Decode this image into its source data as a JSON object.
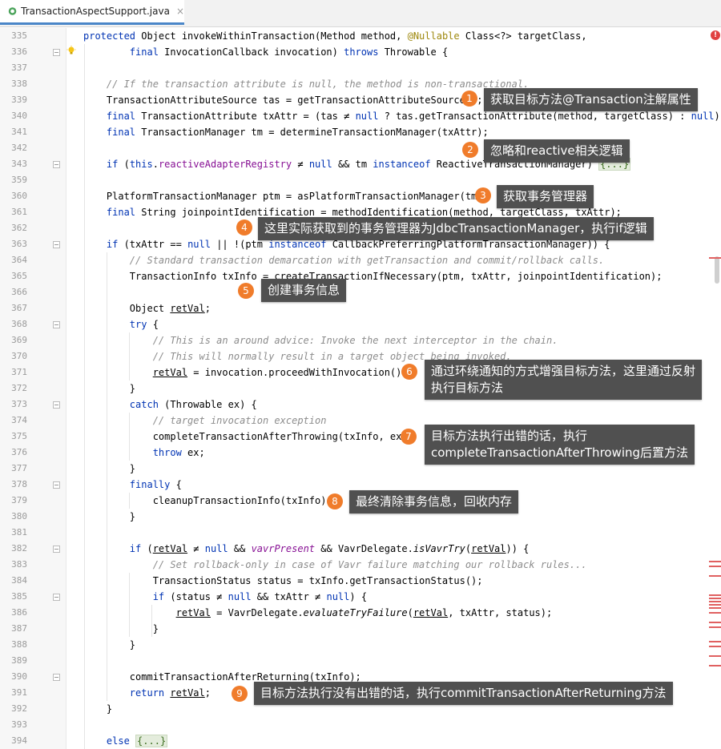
{
  "tab": {
    "filename": "TransactionAspectSupport.java",
    "close": "×"
  },
  "lines": [
    {
      "n": "335",
      "html": "<span class=\"kw\">protected</span> Object invokeWithinTransaction(Method method, <span class=\"ann\">@Nullable</span> Class&lt;?&gt; targetClass,"
    },
    {
      "n": "336",
      "html": "        <span class=\"kw\">final</span> InvocationCallback invocation) <span class=\"kw\">throws</span> Throwable {"
    },
    {
      "n": "337",
      "html": ""
    },
    {
      "n": "338",
      "html": "    <span class=\"cm\">// If the transaction attribute is null, the method is non-transactional.</span>"
    },
    {
      "n": "339",
      "html": "    TransactionAttributeSource tas = getTransactionAttributeSource();"
    },
    {
      "n": "340",
      "html": "    <span class=\"kw\">final</span> TransactionAttribute txAttr = (tas ≠ <span class=\"kw\">null</span> ? tas.getTransactionAttribute(method, targetClass) : <span class=\"kw\">null</span>);"
    },
    {
      "n": "341",
      "html": "    <span class=\"kw\">final</span> TransactionManager tm = determineTransactionManager(txAttr);"
    },
    {
      "n": "342",
      "html": ""
    },
    {
      "n": "343",
      "html": "    <span class=\"kw\">if</span> (<span class=\"kw\">this</span>.<span class=\"fld\">reactiveAdapterRegistry</span> ≠ <span class=\"kw\">null</span> &amp;&amp; tm <span class=\"kw\">instanceof</span> ReactiveTransactionManager) <span class=\"fold\">{...}</span>"
    },
    {
      "n": "359",
      "html": ""
    },
    {
      "n": "360",
      "html": "    PlatformTransactionManager ptm = asPlatformTransactionManager(tm);"
    },
    {
      "n": "361",
      "html": "    <span class=\"kw\">final</span> String joinpointIdentification = methodIdentification(method, targetClass, txAttr);"
    },
    {
      "n": "362",
      "html": ""
    },
    {
      "n": "363",
      "html": "    <span class=\"kw\">if</span> (txAttr == <span class=\"kw\">null</span> || !(ptm <span class=\"kw\">instanceof</span> CallbackPreferringPlatformTransactionManager)) {"
    },
    {
      "n": "364",
      "html": "        <span class=\"cm\">// Standard transaction demarcation with getTransaction and commit/rollback calls.</span>"
    },
    {
      "n": "365",
      "html": "        TransactionInfo txInfo = createTransactionIfNecessary(ptm, txAttr, joinpointIdentification);"
    },
    {
      "n": "366",
      "html": ""
    },
    {
      "n": "367",
      "html": "        Object <span class=\"ul\">retVal</span>;"
    },
    {
      "n": "368",
      "html": "        <span class=\"kw\">try</span> {"
    },
    {
      "n": "369",
      "html": "            <span class=\"cm\">// This is an around advice: Invoke the next interceptor in the chain.</span>"
    },
    {
      "n": "370",
      "html": "            <span class=\"cm\">// This will normally result in a target object being invoked.</span>"
    },
    {
      "n": "371",
      "html": "            <span class=\"ul\">retVal</span> = invocation.proceedWithInvocation();"
    },
    {
      "n": "372",
      "html": "        }"
    },
    {
      "n": "373",
      "html": "        <span class=\"kw\">catch</span> (Throwable ex) {"
    },
    {
      "n": "374",
      "html": "            <span class=\"cm\">// target invocation exception</span>"
    },
    {
      "n": "375",
      "html": "            completeTransactionAfterThrowing(txInfo, ex);"
    },
    {
      "n": "376",
      "html": "            <span class=\"kw\">throw</span> ex;"
    },
    {
      "n": "377",
      "html": "        }"
    },
    {
      "n": "378",
      "html": "        <span class=\"kw\">finally</span> {"
    },
    {
      "n": "379",
      "html": "            cleanupTransactionInfo(txInfo);"
    },
    {
      "n": "380",
      "html": "        }"
    },
    {
      "n": "381",
      "html": ""
    },
    {
      "n": "382",
      "html": "        <span class=\"kw\">if</span> (<span class=\"ul\">retVal</span> ≠ <span class=\"kw\">null</span> &amp;&amp; <span class=\"fldi\">vavrPresent</span> &amp;&amp; VavrDelegate.<span class=\"mst\">isVavrTry</span>(<span class=\"ul\">retVal</span>)) {"
    },
    {
      "n": "383",
      "html": "            <span class=\"cm\">// Set rollback-only in case of Vavr failure matching our rollback rules...</span>"
    },
    {
      "n": "384",
      "html": "            TransactionStatus status = txInfo.getTransactionStatus();"
    },
    {
      "n": "385",
      "html": "            <span class=\"kw\">if</span> (status ≠ <span class=\"kw\">null</span> &amp;&amp; txAttr ≠ <span class=\"kw\">null</span>) {"
    },
    {
      "n": "386",
      "html": "                <span class=\"ul\">retVal</span> = VavrDelegate.<span class=\"mst\">evaluateTryFailure</span>(<span class=\"ul\">retVal</span>, txAttr, status);"
    },
    {
      "n": "387",
      "html": "            }"
    },
    {
      "n": "388",
      "html": "        }"
    },
    {
      "n": "389",
      "html": ""
    },
    {
      "n": "390",
      "html": "        commitTransactionAfterReturning(txInfo);"
    },
    {
      "n": "391",
      "html": "        <span class=\"kw\">return</span> <span class=\"ul\">retVal</span>;"
    },
    {
      "n": "392",
      "html": "    }"
    },
    {
      "n": "393",
      "html": ""
    },
    {
      "n": "394",
      "html": "    <span class=\"kw\">else</span> <span class=\"fold\">{...}</span>"
    }
  ],
  "callouts": [
    {
      "num": "1",
      "text": "获取目标方法@Transaction注解属性"
    },
    {
      "num": "2",
      "text": "忽略和reactive相关逻辑"
    },
    {
      "num": "3",
      "text": "获取事务管理器"
    },
    {
      "num": "4",
      "text": "这里实际获取到的事务管理器为JdbcTransactionManager，执行if逻辑"
    },
    {
      "num": "5",
      "text": "创建事务信息"
    },
    {
      "num": "6",
      "text": "通过环绕通知的方式增强目标方法，这里通过反射\n执行目标方法"
    },
    {
      "num": "7",
      "text": "目标方法执行出错的话，执行\ncompleteTransactionAfterThrowing后置方法"
    },
    {
      "num": "8",
      "text": "最终清除事务信息，回收内存"
    },
    {
      "num": "9",
      "text": "目标方法执行没有出错的话，执行commitTransactionAfterReturning方法"
    }
  ],
  "colors": {
    "keyword": "#0033b3",
    "comment": "#8c8c8c",
    "badge": "#f07c2b",
    "callout_bg": "#505050"
  }
}
